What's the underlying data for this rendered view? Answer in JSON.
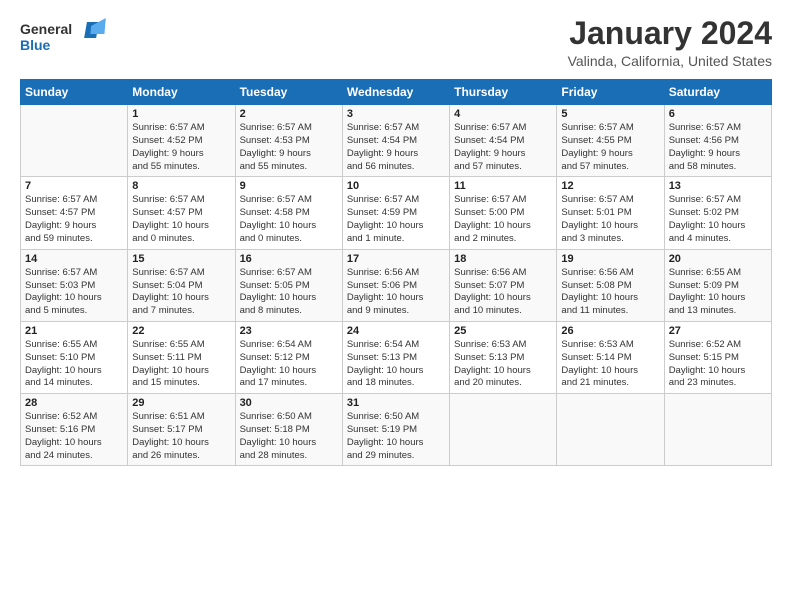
{
  "logo": {
    "text_general": "General",
    "text_blue": "Blue"
  },
  "header": {
    "title": "January 2024",
    "subtitle": "Valinda, California, United States"
  },
  "calendar": {
    "days_of_week": [
      "Sunday",
      "Monday",
      "Tuesday",
      "Wednesday",
      "Thursday",
      "Friday",
      "Saturday"
    ],
    "weeks": [
      [
        {
          "day": "",
          "info": ""
        },
        {
          "day": "1",
          "info": "Sunrise: 6:57 AM\nSunset: 4:52 PM\nDaylight: 9 hours\nand 55 minutes."
        },
        {
          "day": "2",
          "info": "Sunrise: 6:57 AM\nSunset: 4:53 PM\nDaylight: 9 hours\nand 55 minutes."
        },
        {
          "day": "3",
          "info": "Sunrise: 6:57 AM\nSunset: 4:54 PM\nDaylight: 9 hours\nand 56 minutes."
        },
        {
          "day": "4",
          "info": "Sunrise: 6:57 AM\nSunset: 4:54 PM\nDaylight: 9 hours\nand 57 minutes."
        },
        {
          "day": "5",
          "info": "Sunrise: 6:57 AM\nSunset: 4:55 PM\nDaylight: 9 hours\nand 57 minutes."
        },
        {
          "day": "6",
          "info": "Sunrise: 6:57 AM\nSunset: 4:56 PM\nDaylight: 9 hours\nand 58 minutes."
        }
      ],
      [
        {
          "day": "7",
          "info": "Sunrise: 6:57 AM\nSunset: 4:57 PM\nDaylight: 9 hours\nand 59 minutes."
        },
        {
          "day": "8",
          "info": "Sunrise: 6:57 AM\nSunset: 4:57 PM\nDaylight: 10 hours\nand 0 minutes."
        },
        {
          "day": "9",
          "info": "Sunrise: 6:57 AM\nSunset: 4:58 PM\nDaylight: 10 hours\nand 0 minutes."
        },
        {
          "day": "10",
          "info": "Sunrise: 6:57 AM\nSunset: 4:59 PM\nDaylight: 10 hours\nand 1 minute."
        },
        {
          "day": "11",
          "info": "Sunrise: 6:57 AM\nSunset: 5:00 PM\nDaylight: 10 hours\nand 2 minutes."
        },
        {
          "day": "12",
          "info": "Sunrise: 6:57 AM\nSunset: 5:01 PM\nDaylight: 10 hours\nand 3 minutes."
        },
        {
          "day": "13",
          "info": "Sunrise: 6:57 AM\nSunset: 5:02 PM\nDaylight: 10 hours\nand 4 minutes."
        }
      ],
      [
        {
          "day": "14",
          "info": "Sunrise: 6:57 AM\nSunset: 5:03 PM\nDaylight: 10 hours\nand 5 minutes."
        },
        {
          "day": "15",
          "info": "Sunrise: 6:57 AM\nSunset: 5:04 PM\nDaylight: 10 hours\nand 7 minutes."
        },
        {
          "day": "16",
          "info": "Sunrise: 6:57 AM\nSunset: 5:05 PM\nDaylight: 10 hours\nand 8 minutes."
        },
        {
          "day": "17",
          "info": "Sunrise: 6:56 AM\nSunset: 5:06 PM\nDaylight: 10 hours\nand 9 minutes."
        },
        {
          "day": "18",
          "info": "Sunrise: 6:56 AM\nSunset: 5:07 PM\nDaylight: 10 hours\nand 10 minutes."
        },
        {
          "day": "19",
          "info": "Sunrise: 6:56 AM\nSunset: 5:08 PM\nDaylight: 10 hours\nand 11 minutes."
        },
        {
          "day": "20",
          "info": "Sunrise: 6:55 AM\nSunset: 5:09 PM\nDaylight: 10 hours\nand 13 minutes."
        }
      ],
      [
        {
          "day": "21",
          "info": "Sunrise: 6:55 AM\nSunset: 5:10 PM\nDaylight: 10 hours\nand 14 minutes."
        },
        {
          "day": "22",
          "info": "Sunrise: 6:55 AM\nSunset: 5:11 PM\nDaylight: 10 hours\nand 15 minutes."
        },
        {
          "day": "23",
          "info": "Sunrise: 6:54 AM\nSunset: 5:12 PM\nDaylight: 10 hours\nand 17 minutes."
        },
        {
          "day": "24",
          "info": "Sunrise: 6:54 AM\nSunset: 5:13 PM\nDaylight: 10 hours\nand 18 minutes."
        },
        {
          "day": "25",
          "info": "Sunrise: 6:53 AM\nSunset: 5:13 PM\nDaylight: 10 hours\nand 20 minutes."
        },
        {
          "day": "26",
          "info": "Sunrise: 6:53 AM\nSunset: 5:14 PM\nDaylight: 10 hours\nand 21 minutes."
        },
        {
          "day": "27",
          "info": "Sunrise: 6:52 AM\nSunset: 5:15 PM\nDaylight: 10 hours\nand 23 minutes."
        }
      ],
      [
        {
          "day": "28",
          "info": "Sunrise: 6:52 AM\nSunset: 5:16 PM\nDaylight: 10 hours\nand 24 minutes."
        },
        {
          "day": "29",
          "info": "Sunrise: 6:51 AM\nSunset: 5:17 PM\nDaylight: 10 hours\nand 26 minutes."
        },
        {
          "day": "30",
          "info": "Sunrise: 6:50 AM\nSunset: 5:18 PM\nDaylight: 10 hours\nand 28 minutes."
        },
        {
          "day": "31",
          "info": "Sunrise: 6:50 AM\nSunset: 5:19 PM\nDaylight: 10 hours\nand 29 minutes."
        },
        {
          "day": "",
          "info": ""
        },
        {
          "day": "",
          "info": ""
        },
        {
          "day": "",
          "info": ""
        }
      ]
    ]
  }
}
